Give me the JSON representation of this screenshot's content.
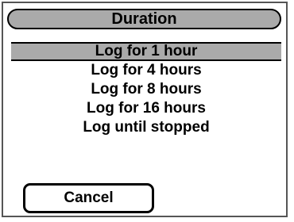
{
  "dialog": {
    "title": "Duration",
    "options": [
      {
        "label": "Log for 1 hour",
        "selected": true
      },
      {
        "label": "Log for 4 hours",
        "selected": false
      },
      {
        "label": "Log for 8 hours",
        "selected": false
      },
      {
        "label": "Log for 16 hours",
        "selected": false
      },
      {
        "label": "Log until stopped",
        "selected": false
      }
    ],
    "cancel_label": "Cancel"
  },
  "colors": {
    "background": "#ffffff",
    "highlight": "#aaaaaa",
    "border": "#000000",
    "frame": "#555555"
  }
}
